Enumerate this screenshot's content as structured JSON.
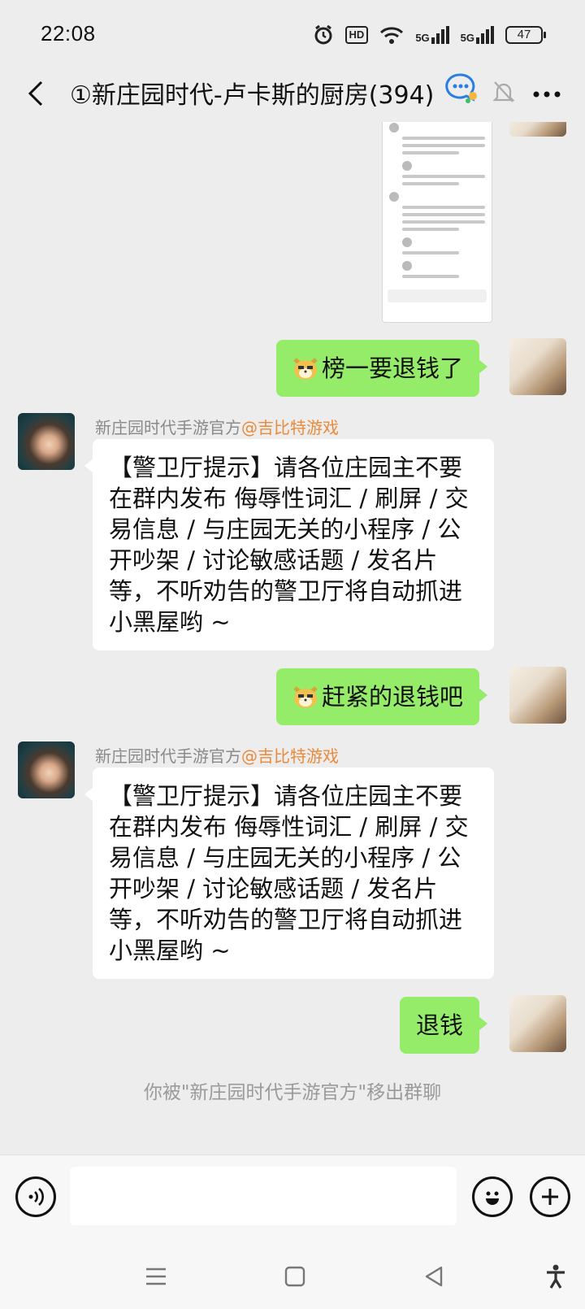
{
  "status_bar": {
    "time": "22:08",
    "hd_label": "HD",
    "net1": "5G",
    "net2": "5G",
    "battery": "47"
  },
  "header": {
    "title": "①新庄园时代-卢卡斯的厨房(394)",
    "icons": [
      "back-arrow-icon",
      "chat-bubbles-icon",
      "muted-bell-icon",
      "more-dots-icon"
    ]
  },
  "messages": [
    {
      "from": "me",
      "type": "image"
    },
    {
      "from": "me",
      "emoji": "cat-emoji",
      "text": "榜一要退钱了"
    },
    {
      "from": "official",
      "sender": "新庄园时代手游官方",
      "mention": "@吉比特游戏",
      "text": "【警卫厅提示】请各位庄园主不要在群内发布 侮辱性词汇 / 刷屏 / 交易信息 / 与庄园无关的小程序 / 公开吵架 / 讨论敏感话题 / 发名片等，不听劝告的警卫厅将自动抓进小黑屋哟 ~"
    },
    {
      "from": "me",
      "emoji": "cat-emoji",
      "text": "赶紧的退钱吧"
    },
    {
      "from": "official",
      "sender": "新庄园时代手游官方",
      "mention": "@吉比特游戏",
      "text": "【警卫厅提示】请各位庄园主不要在群内发布 侮辱性词汇 / 刷屏 / 交易信息 / 与庄园无关的小程序 / 公开吵架 / 讨论敏感话题 / 发名片等，不听劝告的警卫厅将自动抓进小黑屋哟 ~"
    },
    {
      "from": "me",
      "text": "退钱"
    }
  ],
  "system_note": "你被\"新庄园时代手游官方\"移出群聊",
  "input": {
    "value": "",
    "placeholder": ""
  },
  "colors": {
    "bubble_me": "#95ec69",
    "bubble_other": "#ffffff",
    "mention": "#e88a3b",
    "background": "#ededed"
  }
}
